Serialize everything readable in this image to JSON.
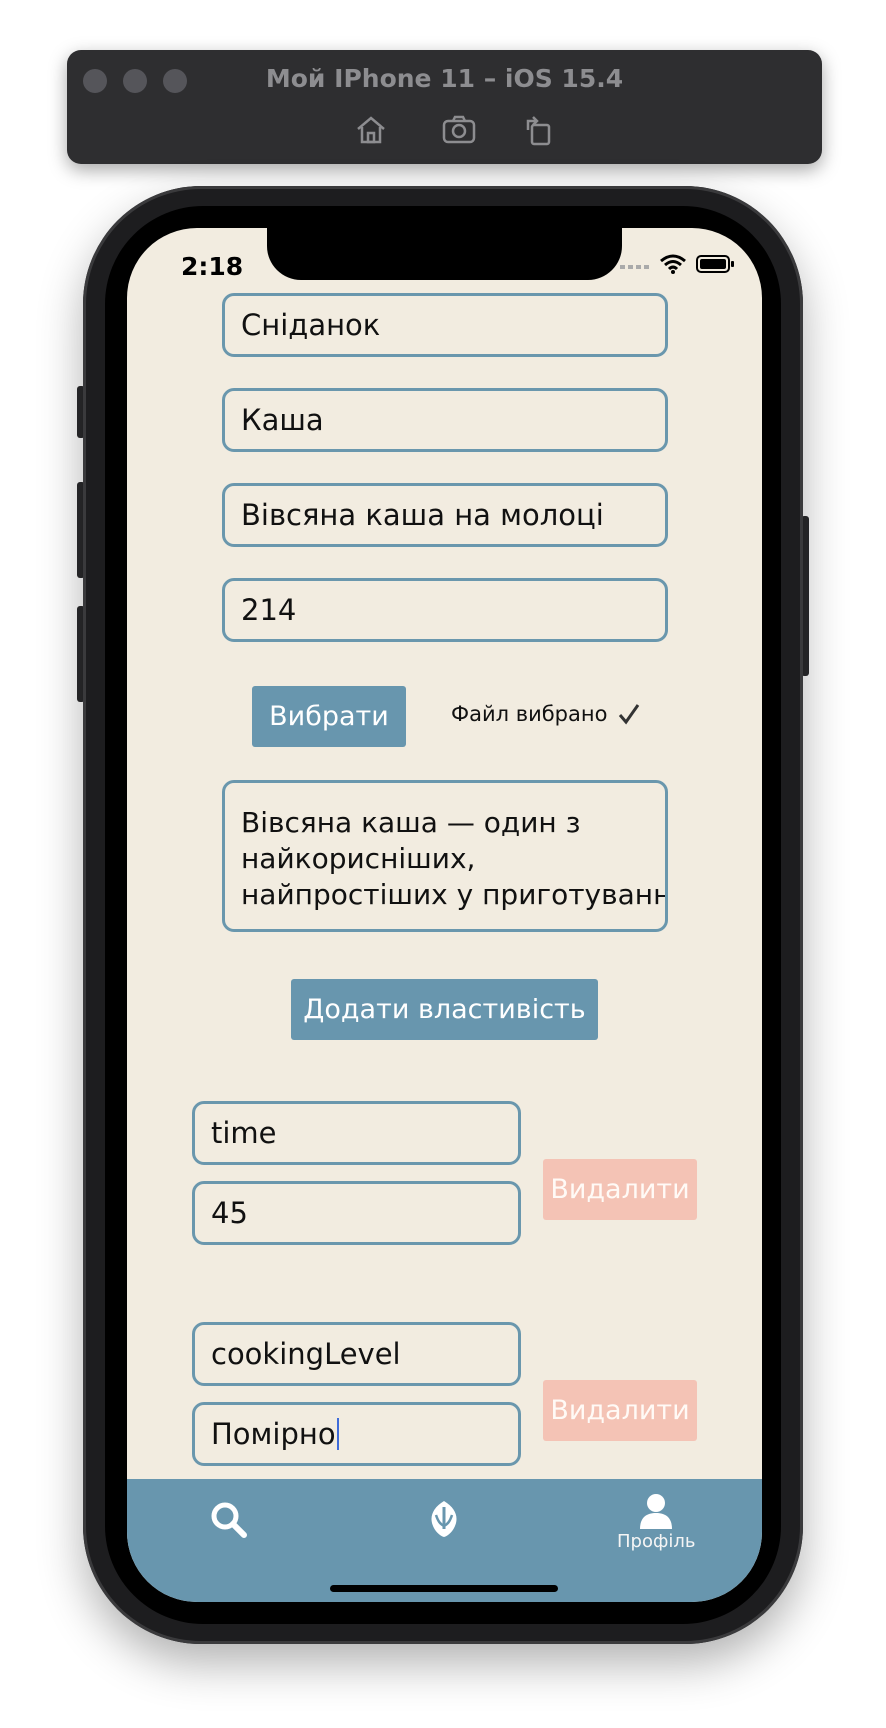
{
  "simulator": {
    "title": "Мой IPhone 11 – iOS 15.4",
    "tools": [
      "home-icon",
      "screenshot-icon",
      "rotate-icon"
    ]
  },
  "status_bar": {
    "time": "2:18",
    "icons": [
      "signal-icon",
      "wifi-icon",
      "battery-icon"
    ]
  },
  "form": {
    "category": "Сніданок",
    "name": "Каша",
    "subtitle": "Вівсяна каша на молоці",
    "calories": "214",
    "choose_button": "Вибрати",
    "file_status": "Файл вибрано",
    "file_status_icon": "checkmark-icon",
    "description_lines": [
      "Вівсяна каша — один з",
      "найкорисніших,",
      "найпростіших у приготуванні,"
    ],
    "add_property_button": "Додати властивість"
  },
  "properties": [
    {
      "key": "time",
      "value": "45",
      "delete_label": "Видалити"
    },
    {
      "key": "cookingLevel",
      "value": "Помірно",
      "delete_label": "Видалити"
    }
  ],
  "tab_bar": {
    "items": [
      {
        "icon": "search-icon",
        "label": ""
      },
      {
        "icon": "rebel-alliance-icon",
        "label": ""
      },
      {
        "icon": "user-icon",
        "label": "Профіль"
      }
    ]
  },
  "colors": {
    "background": "#f2ece0",
    "accent": "#6896ae",
    "field_border": "#6a97ad",
    "delete": "#f4c3b5"
  }
}
